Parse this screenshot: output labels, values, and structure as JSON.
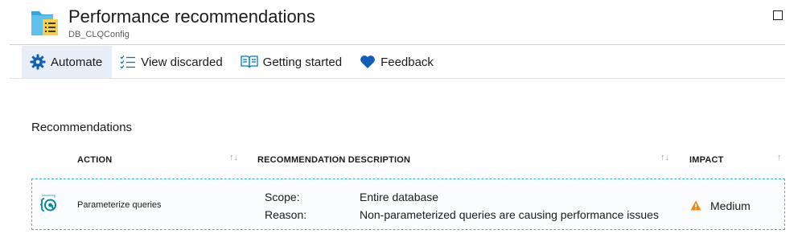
{
  "header": {
    "title": "Performance recommendations",
    "subtitle": "DB_CLQConfig",
    "icon": "database-list-icon"
  },
  "toolbar": {
    "items": [
      {
        "label": "Automate",
        "icon": "gear-icon",
        "active": true
      },
      {
        "label": "View discarded",
        "icon": "checklist-icon"
      },
      {
        "label": "Getting started",
        "icon": "book-icon"
      },
      {
        "label": "Feedback",
        "icon": "heart-icon"
      }
    ]
  },
  "section": {
    "title": "Recommendations"
  },
  "table": {
    "columns": [
      {
        "label": "ACTION",
        "sort_icon": "↑↓"
      },
      {
        "label": "RECOMMENDATION DESCRIPTION",
        "sort_icon": "↑↓"
      },
      {
        "label": "IMPACT",
        "sort_icon": "↑"
      }
    ],
    "rows": [
      {
        "icon": "parameterize-query-icon",
        "action": "Parameterize queries",
        "scope_label": "Scope:",
        "scope_value": "Entire database",
        "reason_label": "Reason:",
        "reason_value": "Non-parameterized queries are causing performance issues",
        "impact": "Medium",
        "impact_icon": "warning-icon"
      }
    ]
  },
  "colors": {
    "accent": "#0078d4",
    "selected_background": "#e8eef7",
    "row_border": "#36b5d6",
    "warning": "#e8891f",
    "row_icon": "#008a99"
  }
}
